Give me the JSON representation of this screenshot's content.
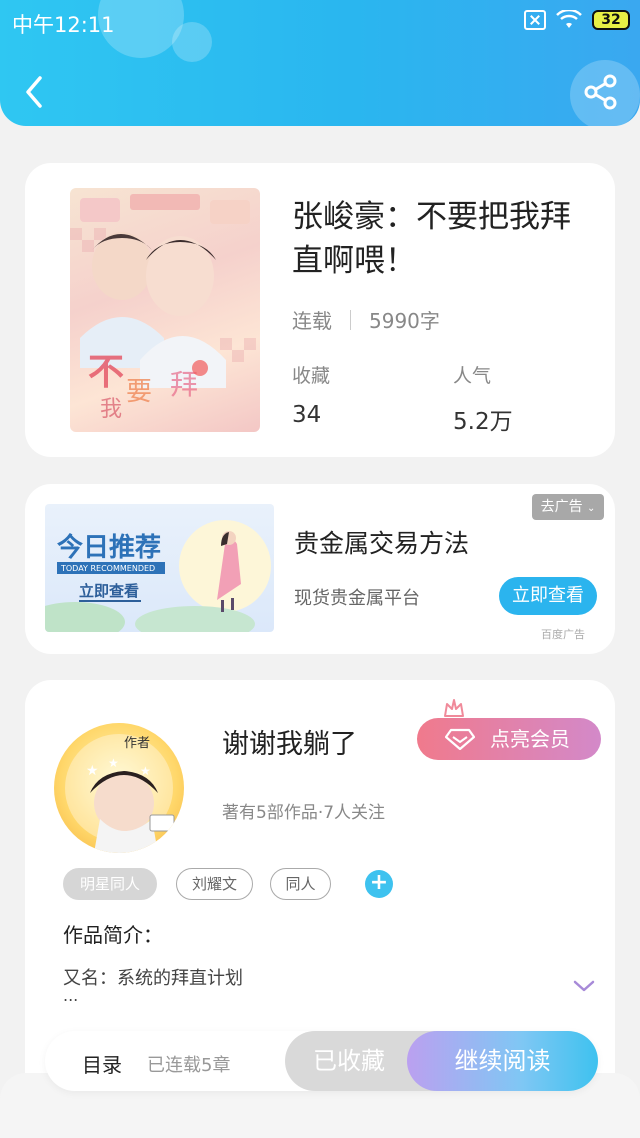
{
  "status_bar": {
    "time": "中午12:11",
    "battery": "32"
  },
  "header": {
    "back_icon": "chevron-left-icon",
    "share_icon": "share-icon"
  },
  "book": {
    "title": "张峻豪：不要把我拜直啊喂！",
    "status": "连载",
    "word_count": "5990字",
    "favorites_label": "收藏",
    "favorites_value": "34",
    "popularity_label": "人气",
    "popularity_value": "5.2万"
  },
  "ad": {
    "image_text_main": "今日推荐",
    "image_text_en": "TODAY RECOMMENDED",
    "image_text_cta": "立即查看",
    "title": "贵金属交易方法",
    "subtitle": "现货贵金属平台",
    "button_label": "立即查看",
    "close_label": "去广告",
    "source": "百度广告"
  },
  "author": {
    "name": "谢谢我躺了",
    "badge": "作者",
    "info": "著有5部作品·7人关注",
    "vip_button": "点亮会员"
  },
  "tags": [
    "明星同人",
    "刘耀文",
    "同人"
  ],
  "intro": {
    "heading": "作品简介：",
    "text": "又名：系统的拜直计划",
    "ellipsis": "..."
  },
  "bottom_bar": {
    "toc_label": "目录",
    "chapters_label": "已连载5章",
    "favorited_label": "已收藏",
    "continue_label": "继续阅读"
  },
  "colors": {
    "accent": "#2bb4ee",
    "vip_start": "#f07a8c",
    "vip_end": "#d389c9"
  }
}
